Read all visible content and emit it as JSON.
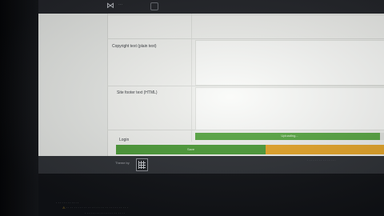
{
  "topbar": {
    "nav_icon": "share-icon",
    "nav_label": "···"
  },
  "form": {
    "copyright_label": "Copyright text (plain text)",
    "footer_html_label": "Site footer text (HTML)",
    "login_label": "Login",
    "progress_label": "Uploading...",
    "progress_value": 0.98,
    "save_label": "Save"
  },
  "footer": {
    "theme_label": "Theme by",
    "right_text": "· · · · · · · · · · · · · · ·"
  },
  "status": {
    "line1": "· · · · · · · · · · · ·",
    "line2_prefix": "⚠",
    "line2": "· · · · · · · · · · · · · · · · · · · · · · · · · · · · · · · ·",
    "line3": "· · · · · · · · · · · · · · · · · · · · ·"
  },
  "colors": {
    "save_green": "#4e9d3a",
    "cancel_orange": "#e7a72b",
    "progress_green": "#5aa845"
  }
}
